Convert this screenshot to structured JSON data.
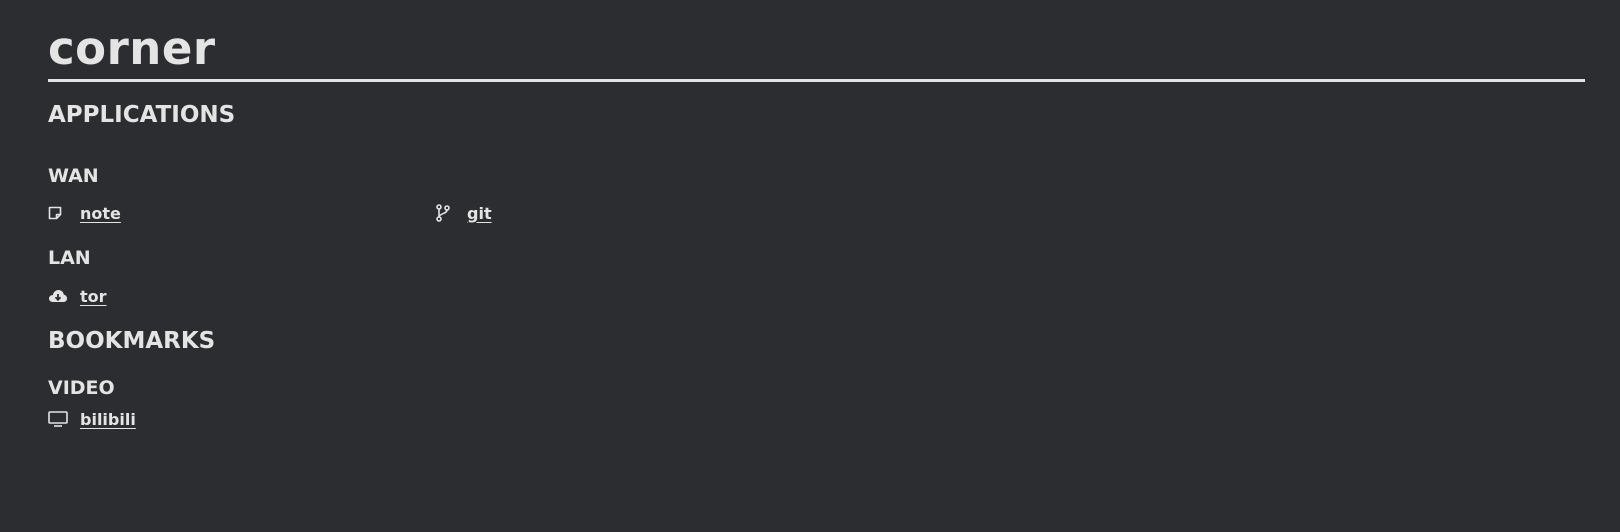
{
  "site": {
    "title": "corner"
  },
  "applications": {
    "heading": "APPLICATIONS",
    "groups": [
      {
        "name": "WAN",
        "items": [
          {
            "label": "note",
            "icon": "note-icon"
          },
          {
            "label": "git",
            "icon": "git-branch-icon"
          }
        ]
      },
      {
        "name": "LAN",
        "items": [
          {
            "label": "tor",
            "icon": "cloud-download-icon"
          }
        ]
      }
    ]
  },
  "bookmarks": {
    "heading": "BOOKMARKS",
    "groups": [
      {
        "name": "VIDEO",
        "items": [
          {
            "label": "bilibili",
            "icon": "monitor-icon"
          }
        ]
      }
    ]
  },
  "colors": {
    "background": "#2c2d31",
    "text": "#e4e4e4"
  }
}
